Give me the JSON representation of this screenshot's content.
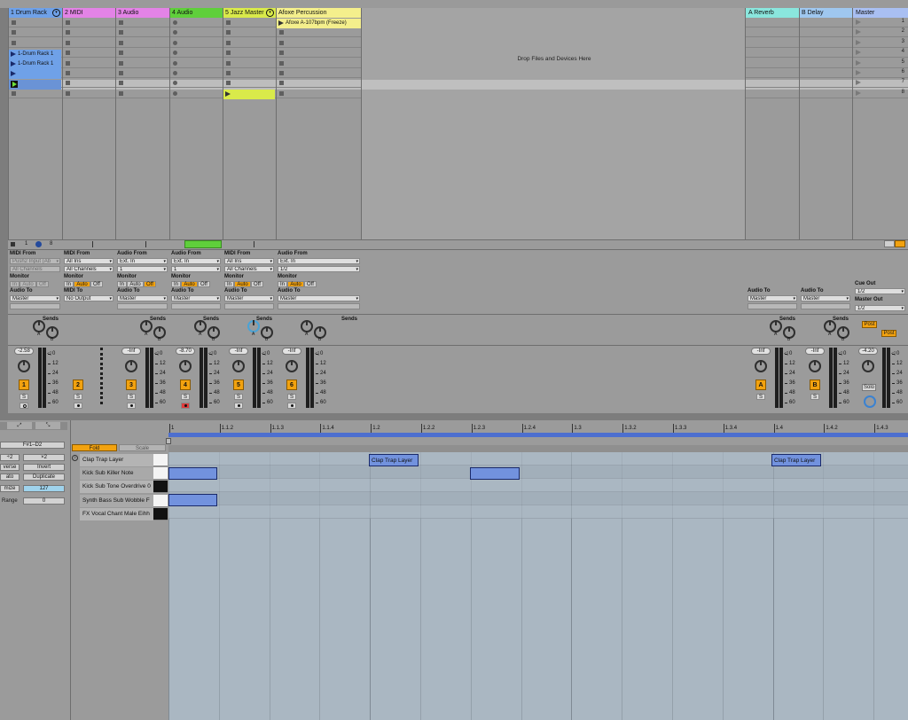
{
  "session": {
    "tracks": [
      {
        "name": "1 Drum Rack",
        "color": "#6fa1e8",
        "has_fold": true
      },
      {
        "name": "2 MIDI",
        "color": "#e383e6"
      },
      {
        "name": "3 Audio",
        "color": "#e383e6"
      },
      {
        "name": "4 Audio",
        "color": "#5fcf3b"
      },
      {
        "name": "5 Jazz Master",
        "color": "#d9ea4a",
        "has_fold": true
      },
      {
        "name": "Afoxe Percussion",
        "color": "#f4ef8c"
      }
    ],
    "returns": [
      {
        "name": "A Reverb",
        "color": "#8ae6dd"
      },
      {
        "name": "B Delay",
        "color": "#9fc7ef"
      },
      {
        "name": "Master",
        "color": "#a9bff2"
      }
    ],
    "drop_text": "Drop Files and Devices Here",
    "clips": {
      "drum1": "1-Drum Rack 1",
      "drum2": "1-Drum Rack 1",
      "afoxe": "Afoxe A-107bpm (Freeze)"
    },
    "scenes": [
      "1",
      "2",
      "3",
      "4",
      "5",
      "6",
      "7",
      "8"
    ],
    "drum_status": {
      "a": "1",
      "b": "8"
    }
  },
  "io": {
    "midi_from": "MIDI From",
    "audio_from": "Audio From",
    "monitor": "Monitor",
    "audio_to": "Audio To",
    "midi_to": "MIDI To",
    "cue_out": "Cue Out",
    "master_out": "Master Out",
    "in": "In",
    "auto": "Auto",
    "off": "Off",
    "t1_from": "Push2 Input (Ab",
    "t1_ch": "All Channels",
    "t2_from": "All Ins",
    "t2_ch": "All Channels",
    "t3_from": "Ext. In",
    "t3_ch": "1",
    "t4_from": "Ext. In",
    "t4_ch": "1",
    "t5_from": "All Ins",
    "t5_ch": "All Channels",
    "t6_from": "Ext. In",
    "t6_ch": "1/2",
    "master": "Master",
    "no_output": "No Output",
    "cue_val": "1/2",
    "master_out_val": "1/2"
  },
  "mixer": {
    "sends": "Sends",
    "send_a": "A",
    "send_b": "B",
    "post": "Post",
    "solo": "Solo",
    "s": "S",
    "volumes": [
      "-2.58",
      "-Inf",
      "-8.70",
      "-Inf",
      "-Inf",
      "-Inf",
      "-Inf",
      "-4.20"
    ],
    "scale": [
      "0",
      "12",
      "24",
      "36",
      "48",
      "60"
    ],
    "numbers": [
      "1",
      "2",
      "3",
      "4",
      "5",
      "6"
    ],
    "return_letters": [
      "A",
      "B"
    ]
  },
  "clip_view": {
    "note_range": "F#1–D2",
    "half": "÷2",
    "double": "×2",
    "reverse": "verse",
    "invert": "Invert",
    "legato": "ato",
    "duplicate": "Duplicate",
    "quantize": "mize",
    "velocity": "127",
    "range_label": "Range",
    "range_value": "0",
    "fold": "Fold",
    "scale_btn": "Scale",
    "rows": [
      "Clap Trap Layer",
      "Kick Sub Killer Note",
      "Kick Sub Tone Overdrive 0",
      "Synth Bass Sub Wobble F",
      "FX Vocal Chant Male Eihh"
    ],
    "note_label": "Clap Trap Layer",
    "ruler": [
      "1",
      "1.1.2",
      "1.1.3",
      "1.1.4",
      "1.2",
      "1.2.2",
      "1.2.3",
      "1.2.4",
      "1.3",
      "1.3.2",
      "1.3.3",
      "1.3.4",
      "1.4",
      "1.4.2",
      "1.4.3"
    ]
  }
}
